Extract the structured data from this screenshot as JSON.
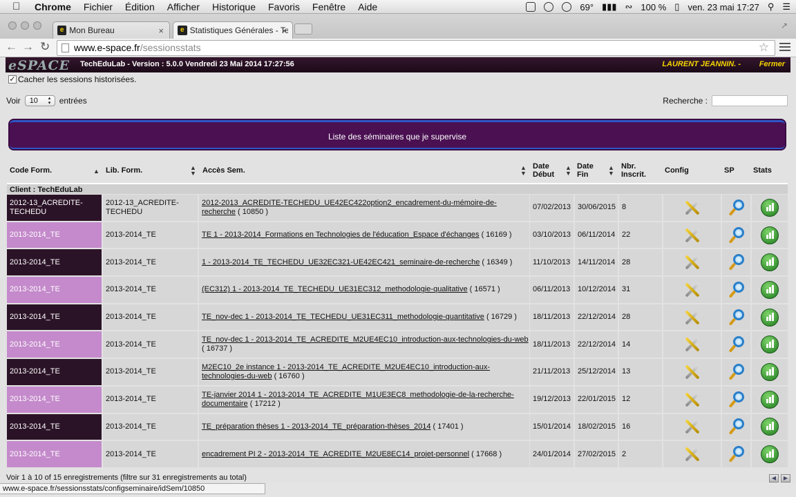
{
  "menubar": {
    "app": "Chrome",
    "items": [
      "Fichier",
      "Édition",
      "Afficher",
      "Historique",
      "Favoris",
      "Fenêtre",
      "Aide"
    ],
    "temp": "69°",
    "battery": "100 %",
    "clock": "ven. 23 mai  17:27"
  },
  "tabs": [
    {
      "title": "Mon Bureau"
    },
    {
      "title": "Statistiques Générales - Te"
    }
  ],
  "address": {
    "domain": "www.e-space.fr",
    "path": "/sessionsstats"
  },
  "appbar": {
    "logo": "eSPACE",
    "version": "TechEduLab - Version : 5.0.0 Vendredi 23 Mai 2014     17:27:56",
    "user": "LAURENT JEANNIN. -",
    "close": "Fermer"
  },
  "controls": {
    "hide_label": "Cacher les sessions historisées.",
    "show_prefix": "Voir",
    "show_value": "10",
    "show_suffix": "entrées",
    "search_label": "Recherche :"
  },
  "banner": "Liste des séminaires que je supervise",
  "table": {
    "headers": {
      "code": "Code Form.",
      "lib": "Lib. Form.",
      "access": "Accès Sem.",
      "start1": "Date",
      "start2": "Début",
      "end1": "Date",
      "end2": "Fin",
      "count1": "Nbr.",
      "count2": "Inscrit.",
      "config": "Config",
      "sp": "SP",
      "stats": "Stats"
    },
    "group": "Client : TechEduLab",
    "rows": [
      {
        "code": "2012-13_ACREDITE-TECHEDU",
        "lib": "2012-13_ACREDITE-TECHEDU",
        "link": "2012-2013_ACREDITE-TECHEDU_UE42EC422option2_encadrement-du-mémoire-de-recherche",
        "id": "( 10850 )",
        "start": "07/02/2013",
        "end": "30/06/2015",
        "count": "8"
      },
      {
        "code": "2013-2014_TE",
        "lib": "2013-2014_TE",
        "link": "TE 1 - 2013-2014_Formations en Technologies de l'éducation_Espace d'échanges",
        "id": "( 16169 )",
        "start": "03/10/2013",
        "end": "06/11/2014",
        "count": "22"
      },
      {
        "code": "2013-2014_TE",
        "lib": "2013-2014_TE",
        "link": "1 - 2013-2014_TE_TECHEDU_UE32EC321-UE42EC421_seminaire-de-recherche",
        "id": "( 16349 )",
        "start": "11/10/2013",
        "end": "14/11/2014",
        "count": "28"
      },
      {
        "code": "2013-2014_TE",
        "lib": "2013-2014_TE",
        "link": "(EC312) 1 - 2013-2014_TE_TECHEDU_UE31EC312_methodologie-qualitative",
        "id": "( 16571 )",
        "start": "06/11/2013",
        "end": "10/12/2014",
        "count": "31"
      },
      {
        "code": "2013-2014_TE",
        "lib": "2013-2014_TE",
        "link": "TE_nov-dec 1 - 2013-2014_TE_TECHEDU_UE31EC311_methodologie-quantitative",
        "id": "( 16729 )",
        "start": "18/11/2013",
        "end": "22/12/2014",
        "count": "28"
      },
      {
        "code": "2013-2014_TE",
        "lib": "2013-2014_TE",
        "link": "TE_nov-dec 1 - 2013-2014_TE_ACREDITE_M2UE4EC10_introduction-aux-technologies-du-web",
        "id": "( 16737 )",
        "start": "18/11/2013",
        "end": "22/12/2014",
        "count": "14"
      },
      {
        "code": "2013-2014_TE",
        "lib": "2013-2014_TE",
        "link": "M2EC10_2e instance 1 - 2013-2014_TE_ACREDITE_M2UE4EC10_introduction-aux-technologies-du-web",
        "id": "( 16760 )",
        "start": "21/11/2013",
        "end": "25/12/2014",
        "count": "13"
      },
      {
        "code": "2013-2014_TE",
        "lib": "2013-2014_TE",
        "link": "TE-janvier 2014 1 - 2013-2014_TE_ACREDITE_M1UE3EC8_methodologie-de-la-recherche-documentaire",
        "id": "( 17212 )",
        "start": "19/12/2013",
        "end": "22/01/2015",
        "count": "12"
      },
      {
        "code": "2013-2014_TE",
        "lib": "2013-2014_TE",
        "link": "TE_préparation thèses 1 - 2013-2014_TE_préparation-thèses_2014",
        "id": "( 17401 )",
        "start": "15/01/2014",
        "end": "18/02/2015",
        "count": "16"
      },
      {
        "code": "2013-2014_TE",
        "lib": "2013-2014_TE",
        "link": "encadrement PI 2 - 2013-2014_TE_ACREDITE_M2UE8EC14_projet-personnel",
        "id": "( 17668 )",
        "start": "24/01/2014",
        "end": "27/02/2015",
        "count": "2"
      }
    ]
  },
  "footer_info": "Voir 1 à 10 of 15 enregistrements (filtre sur 31 enregistrements au total)",
  "status_url": "www.e-space.fr/sessionsstats/configseminaire/idSem/10850"
}
